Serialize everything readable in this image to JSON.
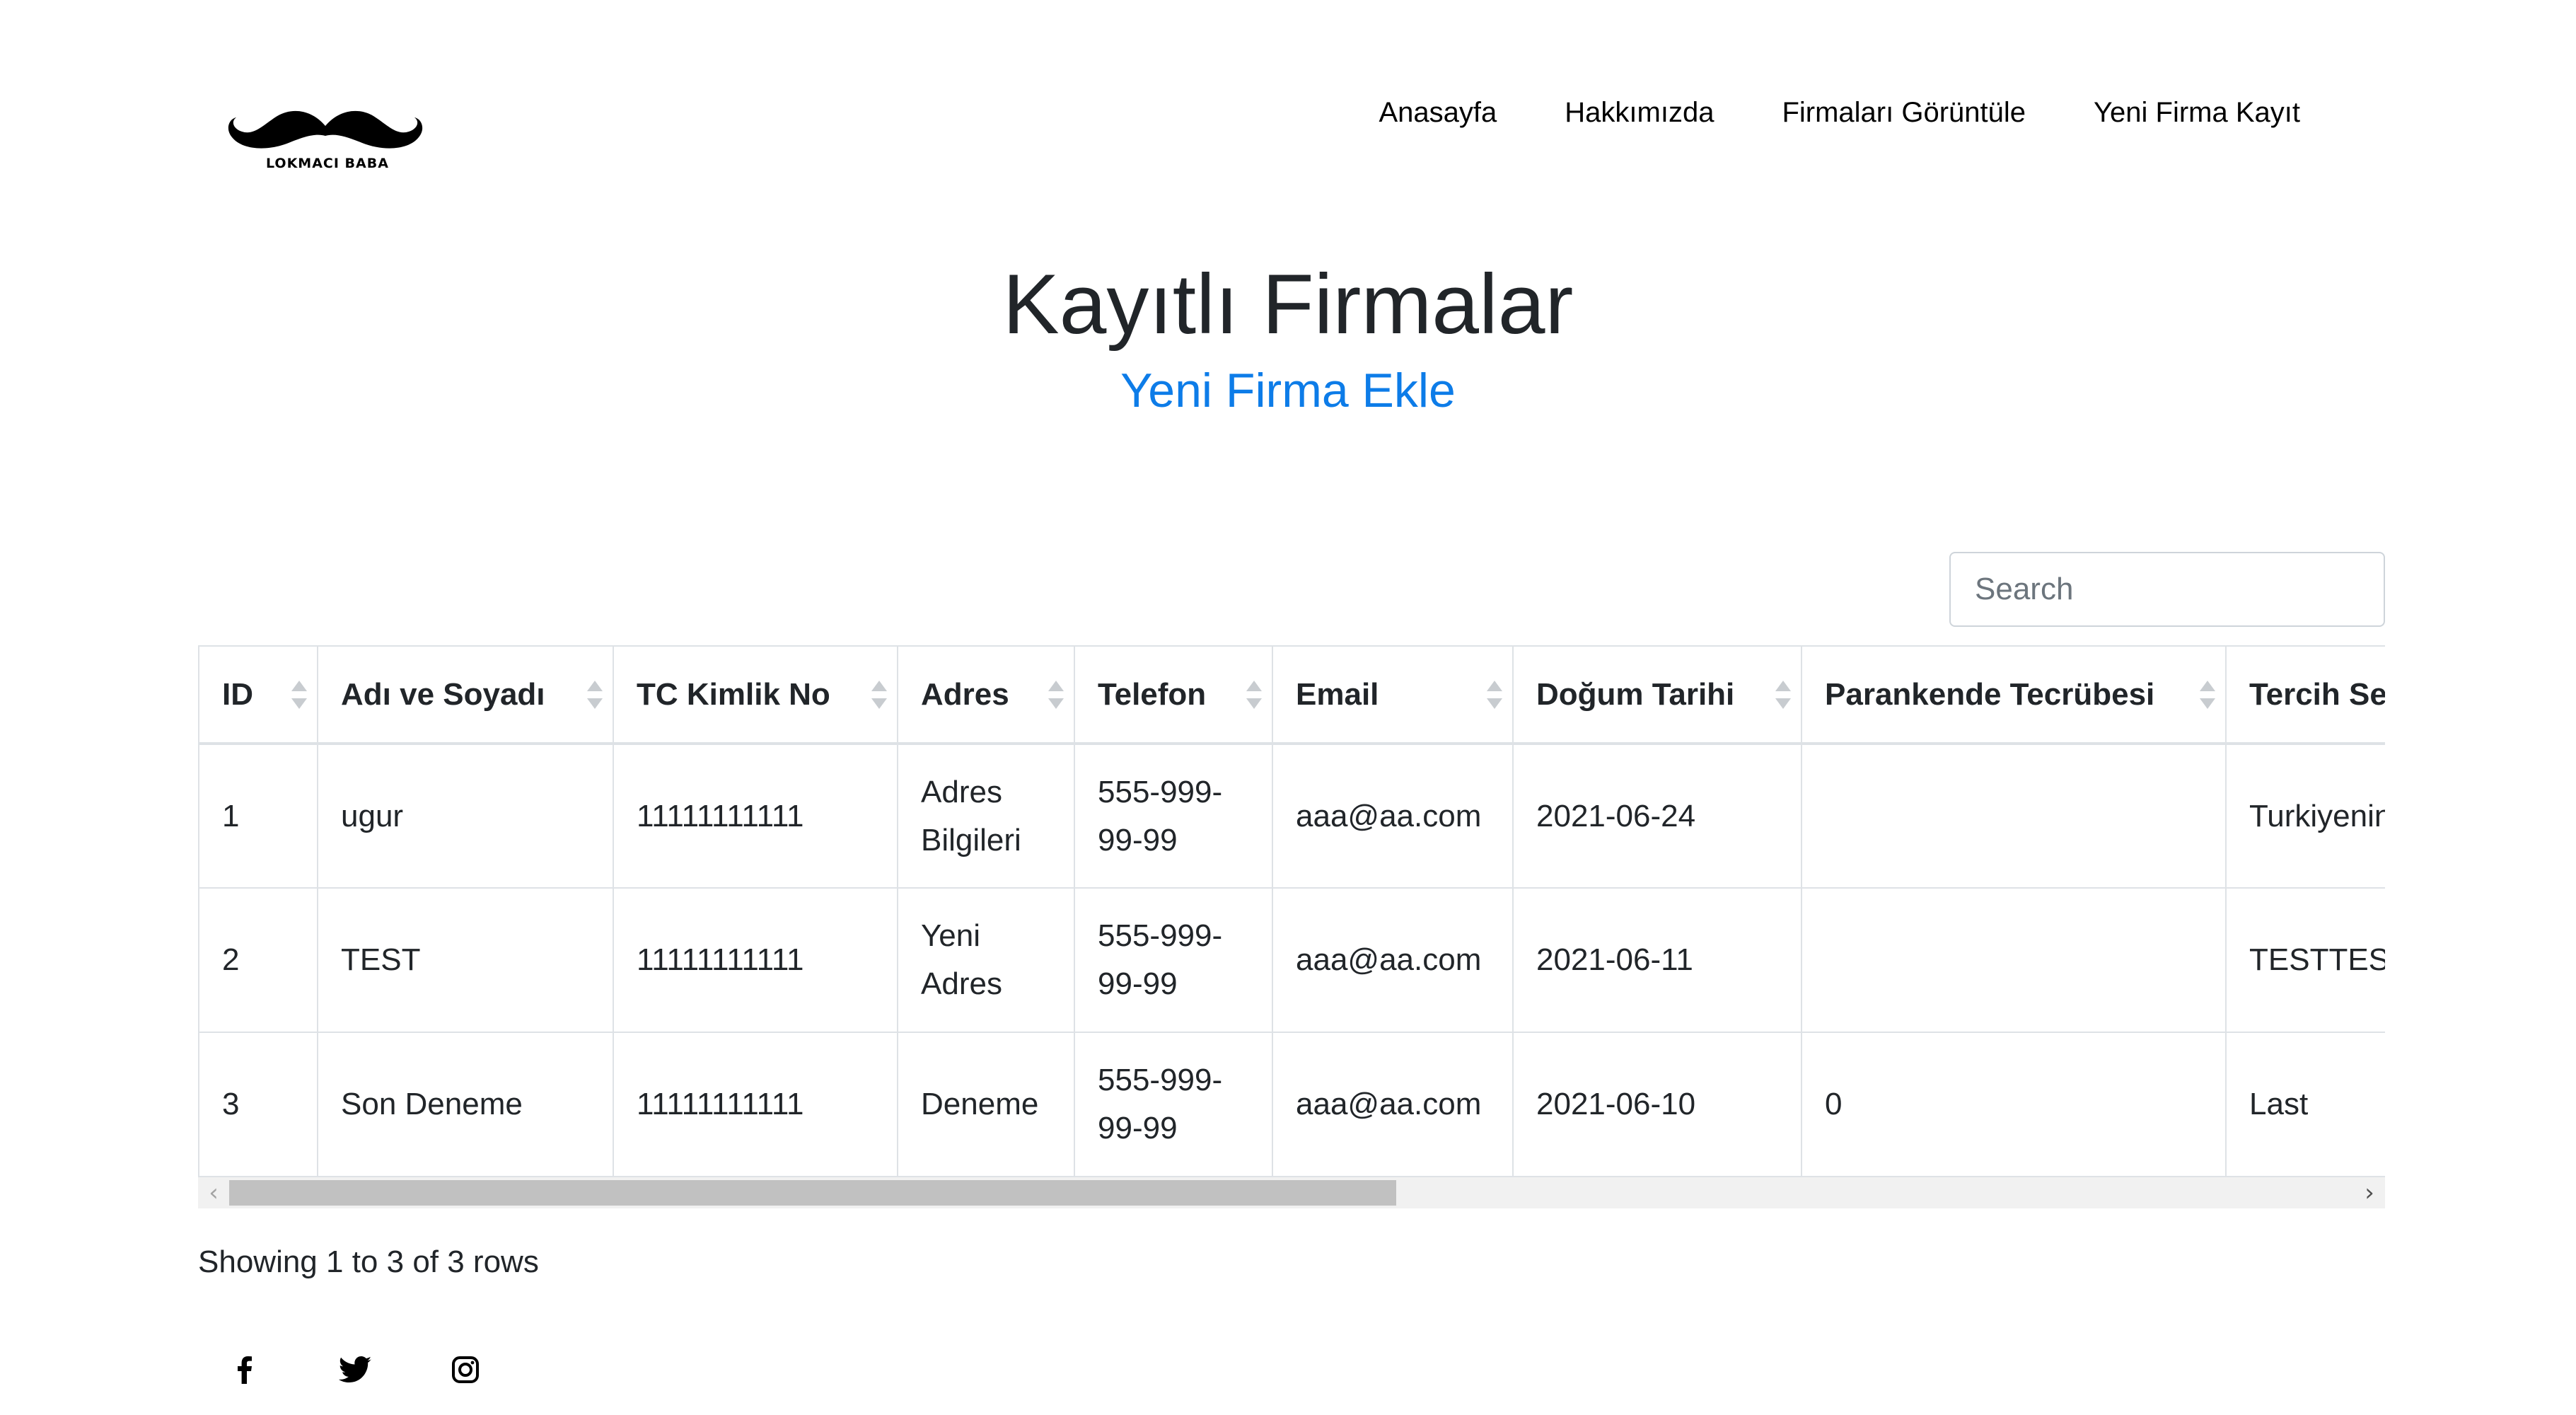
{
  "brand": {
    "logo_text": "LOKMACI BABA"
  },
  "nav": {
    "items": [
      {
        "label": "Anasayfa"
      },
      {
        "label": "Hakkımızda"
      },
      {
        "label": "Firmaları Görüntüle"
      },
      {
        "label": "Yeni Firma Kayıt"
      }
    ]
  },
  "main": {
    "title": "Kayıtlı Firmalar",
    "add_link": "Yeni Firma Ekle"
  },
  "search": {
    "placeholder": "Search",
    "value": ""
  },
  "table": {
    "columns": [
      "ID",
      "Adı ve Soyadı",
      "TC Kimlik No",
      "Adres",
      "Telefon",
      "Email",
      "Doğum Tarihi",
      "Parankende Tecrübesi",
      "Tercih Sebebi"
    ],
    "rows": [
      [
        "1",
        "ugur",
        "11111111111",
        "Adres Bilgileri",
        "555-999-99-99",
        "aaa@aa.com",
        "2021-06-24",
        "",
        "Turkiyenin I"
      ],
      [
        "2",
        "TEST",
        "11111111111",
        "Yeni Adres",
        "555-999-99-99",
        "aaa@aa.com",
        "2021-06-11",
        "",
        "TESTTEST"
      ],
      [
        "3",
        "Son Deneme",
        "11111111111",
        "Deneme",
        "555-999-99-99",
        "aaa@aa.com",
        "2021-06-10",
        "0",
        "Last"
      ]
    ]
  },
  "pagination": {
    "summary": "Showing 1 to 3 of 3 rows"
  },
  "social": {
    "icons": [
      "facebook-icon",
      "twitter-icon",
      "instagram-icon"
    ]
  },
  "colors": {
    "link": "#0d7ce8",
    "text": "#212529",
    "border": "#dee2e6"
  }
}
